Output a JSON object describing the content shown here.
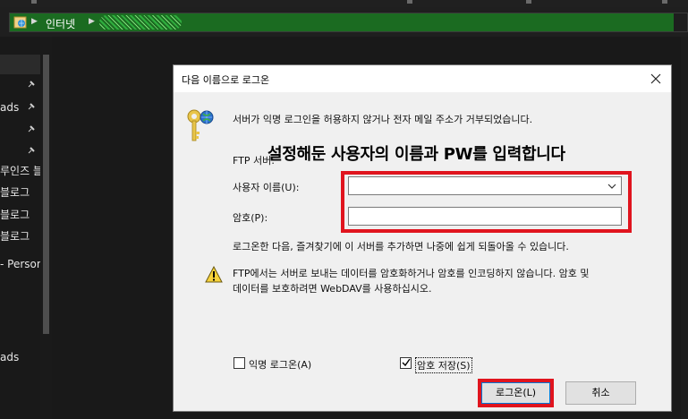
{
  "address": {
    "location": "인터넷"
  },
  "nav": {
    "items": [
      {
        "label": "ads",
        "pinned": true
      },
      {
        "label": "",
        "pinned": true
      },
      {
        "label": "",
        "pinned": true
      },
      {
        "label": "루인즈 블",
        "pinned": false
      },
      {
        "label": "블로그",
        "pinned": false
      },
      {
        "label": "블로그",
        "pinned": false
      },
      {
        "label": "블로그",
        "pinned": false
      },
      {
        "label": "- Person",
        "pinned": false
      },
      {
        "label": "ads",
        "pinned": false
      }
    ]
  },
  "dialog": {
    "title": "다음 이름으로 로그온",
    "message": "서버가 익명 로그인을 허용하지 않거나 전자 메일 주소가 거부되었습니다.",
    "ftp_label": "FTP 서버:",
    "username_label": "사용자 이름(U):",
    "username_value": "",
    "password_label": "암호(P):",
    "password_value": "",
    "info_text": "로그온한 다음, 즐겨찾기에 이 서버를 추가하면 나중에 쉽게 되돌아올 수 있습니다.",
    "warning_line1": "FTP에서는 서버로 보내는 데이터를 암호화하거나 암호를 인코딩하지 않습니다. 암호 및",
    "warning_line2": "데이터를 보호하려면 WebDAV를 사용하십시오.",
    "anonymous_label": "익명 로그온(A)",
    "anonymous_checked": false,
    "save_password_label": "암호 저장(S)",
    "save_password_checked": true,
    "login_button": "로그온(L)",
    "cancel_button": "취소"
  },
  "annotation": {
    "text": "설정해둔 사용자의 이름과 PW를 입력합니다",
    "highlight_color": "#e0141e"
  },
  "colors": {
    "address_green": "#1b6b21",
    "default_button_border": "#0078d7"
  }
}
